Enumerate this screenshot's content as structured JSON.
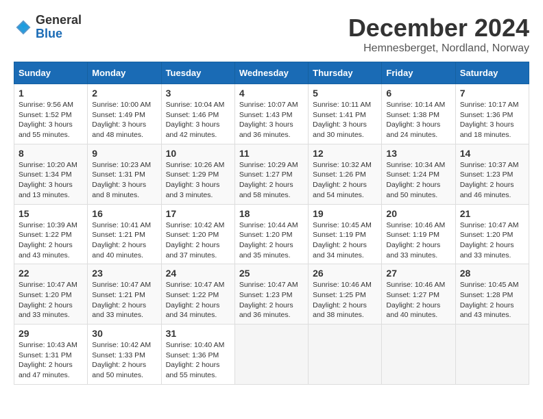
{
  "logo": {
    "general": "General",
    "blue": "Blue"
  },
  "header": {
    "title": "December 2024",
    "subtitle": "Hemnesberget, Nordland, Norway"
  },
  "weekdays": [
    "Sunday",
    "Monday",
    "Tuesday",
    "Wednesday",
    "Thursday",
    "Friday",
    "Saturday"
  ],
  "weeks": [
    [
      {
        "day": "1",
        "sunrise": "9:56 AM",
        "sunset": "1:52 PM",
        "daylight": "3 hours and 55 minutes."
      },
      {
        "day": "2",
        "sunrise": "10:00 AM",
        "sunset": "1:49 PM",
        "daylight": "3 hours and 48 minutes."
      },
      {
        "day": "3",
        "sunrise": "10:04 AM",
        "sunset": "1:46 PM",
        "daylight": "3 hours and 42 minutes."
      },
      {
        "day": "4",
        "sunrise": "10:07 AM",
        "sunset": "1:43 PM",
        "daylight": "3 hours and 36 minutes."
      },
      {
        "day": "5",
        "sunrise": "10:11 AM",
        "sunset": "1:41 PM",
        "daylight": "3 hours and 30 minutes."
      },
      {
        "day": "6",
        "sunrise": "10:14 AM",
        "sunset": "1:38 PM",
        "daylight": "3 hours and 24 minutes."
      },
      {
        "day": "7",
        "sunrise": "10:17 AM",
        "sunset": "1:36 PM",
        "daylight": "3 hours and 18 minutes."
      }
    ],
    [
      {
        "day": "8",
        "sunrise": "10:20 AM",
        "sunset": "1:34 PM",
        "daylight": "3 hours and 13 minutes."
      },
      {
        "day": "9",
        "sunrise": "10:23 AM",
        "sunset": "1:31 PM",
        "daylight": "3 hours and 8 minutes."
      },
      {
        "day": "10",
        "sunrise": "10:26 AM",
        "sunset": "1:29 PM",
        "daylight": "3 hours and 3 minutes."
      },
      {
        "day": "11",
        "sunrise": "10:29 AM",
        "sunset": "1:27 PM",
        "daylight": "2 hours and 58 minutes."
      },
      {
        "day": "12",
        "sunrise": "10:32 AM",
        "sunset": "1:26 PM",
        "daylight": "2 hours and 54 minutes."
      },
      {
        "day": "13",
        "sunrise": "10:34 AM",
        "sunset": "1:24 PM",
        "daylight": "2 hours and 50 minutes."
      },
      {
        "day": "14",
        "sunrise": "10:37 AM",
        "sunset": "1:23 PM",
        "daylight": "2 hours and 46 minutes."
      }
    ],
    [
      {
        "day": "15",
        "sunrise": "10:39 AM",
        "sunset": "1:22 PM",
        "daylight": "2 hours and 43 minutes."
      },
      {
        "day": "16",
        "sunrise": "10:41 AM",
        "sunset": "1:21 PM",
        "daylight": "2 hours and 40 minutes."
      },
      {
        "day": "17",
        "sunrise": "10:42 AM",
        "sunset": "1:20 PM",
        "daylight": "2 hours and 37 minutes."
      },
      {
        "day": "18",
        "sunrise": "10:44 AM",
        "sunset": "1:20 PM",
        "daylight": "2 hours and 35 minutes."
      },
      {
        "day": "19",
        "sunrise": "10:45 AM",
        "sunset": "1:19 PM",
        "daylight": "2 hours and 34 minutes."
      },
      {
        "day": "20",
        "sunrise": "10:46 AM",
        "sunset": "1:19 PM",
        "daylight": "2 hours and 33 minutes."
      },
      {
        "day": "21",
        "sunrise": "10:47 AM",
        "sunset": "1:20 PM",
        "daylight": "2 hours and 33 minutes."
      }
    ],
    [
      {
        "day": "22",
        "sunrise": "10:47 AM",
        "sunset": "1:20 PM",
        "daylight": "2 hours and 33 minutes."
      },
      {
        "day": "23",
        "sunrise": "10:47 AM",
        "sunset": "1:21 PM",
        "daylight": "2 hours and 33 minutes."
      },
      {
        "day": "24",
        "sunrise": "10:47 AM",
        "sunset": "1:22 PM",
        "daylight": "2 hours and 34 minutes."
      },
      {
        "day": "25",
        "sunrise": "10:47 AM",
        "sunset": "1:23 PM",
        "daylight": "2 hours and 36 minutes."
      },
      {
        "day": "26",
        "sunrise": "10:46 AM",
        "sunset": "1:25 PM",
        "daylight": "2 hours and 38 minutes."
      },
      {
        "day": "27",
        "sunrise": "10:46 AM",
        "sunset": "1:27 PM",
        "daylight": "2 hours and 40 minutes."
      },
      {
        "day": "28",
        "sunrise": "10:45 AM",
        "sunset": "1:28 PM",
        "daylight": "2 hours and 43 minutes."
      }
    ],
    [
      {
        "day": "29",
        "sunrise": "10:43 AM",
        "sunset": "1:31 PM",
        "daylight": "2 hours and 47 minutes."
      },
      {
        "day": "30",
        "sunrise": "10:42 AM",
        "sunset": "1:33 PM",
        "daylight": "2 hours and 50 minutes."
      },
      {
        "day": "31",
        "sunrise": "10:40 AM",
        "sunset": "1:36 PM",
        "daylight": "2 hours and 55 minutes."
      },
      null,
      null,
      null,
      null
    ]
  ]
}
